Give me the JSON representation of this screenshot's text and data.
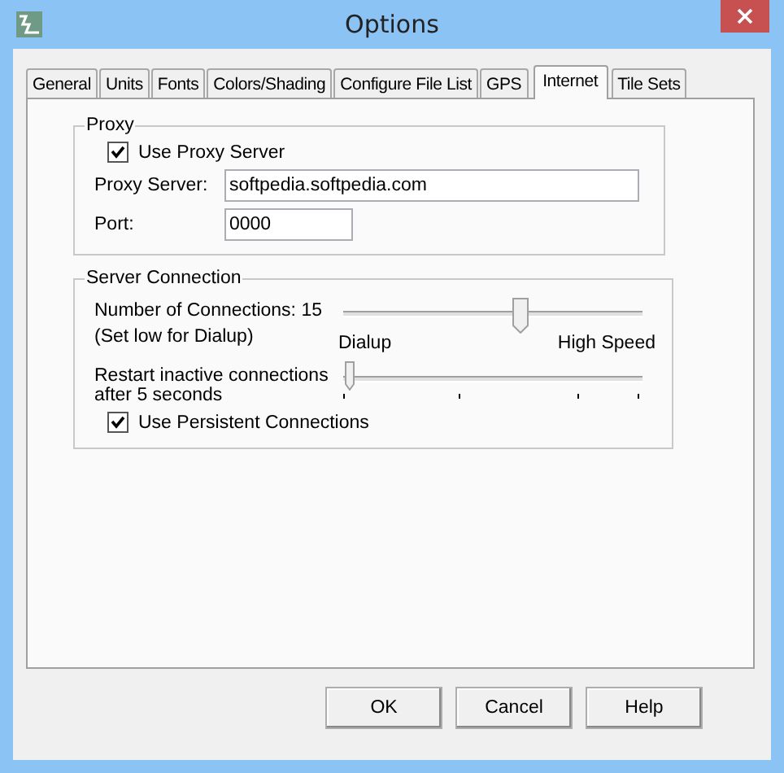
{
  "window": {
    "title": "Options"
  },
  "tabs": [
    {
      "label": "General",
      "selected": false
    },
    {
      "label": "Units",
      "selected": false
    },
    {
      "label": "Fonts",
      "selected": false
    },
    {
      "label": "Colors/Shading",
      "selected": false
    },
    {
      "label": "Configure File List",
      "selected": false
    },
    {
      "label": "GPS",
      "selected": false
    },
    {
      "label": "Internet",
      "selected": true
    },
    {
      "label": "Tile Sets",
      "selected": false
    }
  ],
  "proxy": {
    "title": "Proxy",
    "use_proxy": {
      "label": "Use Proxy Server",
      "checked": true
    },
    "server": {
      "label": "Proxy Server:",
      "value": "softpedia.softpedia.com"
    },
    "port": {
      "label": "Port:",
      "value": "0000"
    }
  },
  "server_connection": {
    "title": "Server Connection",
    "connections": {
      "label": "Number of Connections: 15",
      "hint": "(Set low for Dialup)",
      "level": 0.59,
      "min_label": "Dialup",
      "max_label": "High Speed"
    },
    "restart": {
      "label": "Restart inactive connections after 5 seconds",
      "level": 0
    },
    "persistent": {
      "label": "Use Persistent Connections",
      "checked": true
    }
  },
  "buttons": [
    "OK",
    "Cancel",
    "Help"
  ]
}
